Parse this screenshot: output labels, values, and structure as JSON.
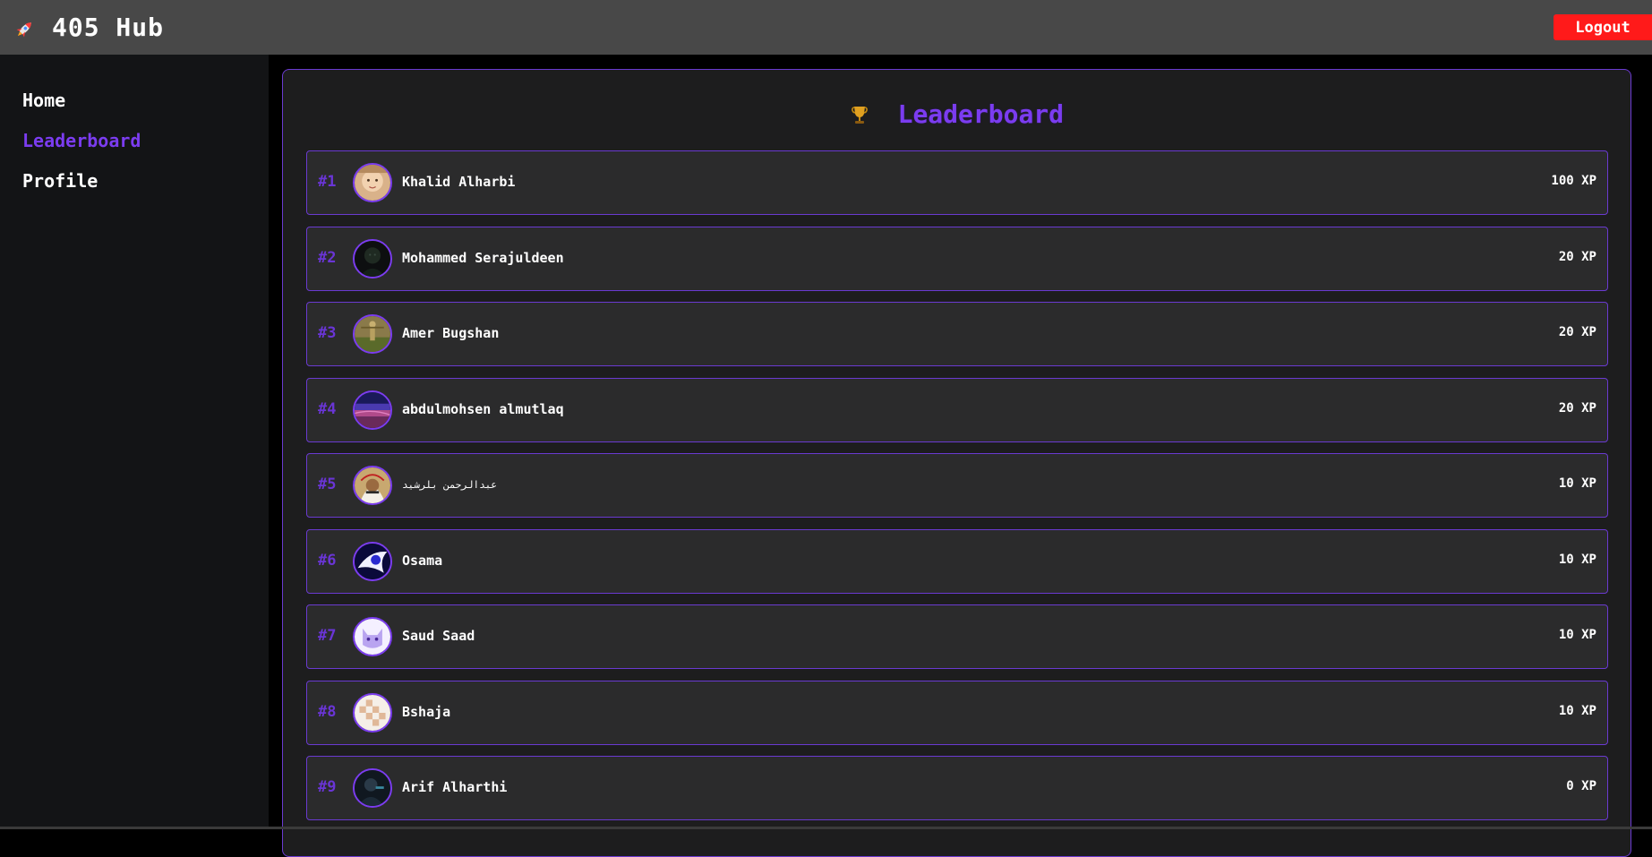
{
  "app": {
    "title": "405 Hub",
    "logout_label": "Logout"
  },
  "sidebar": {
    "items": [
      {
        "label": "Home",
        "active": false
      },
      {
        "label": "Leaderboard",
        "active": true
      },
      {
        "label": "Profile",
        "active": false
      }
    ]
  },
  "leaderboard": {
    "title": "Leaderboard",
    "rows": [
      {
        "rank": "#1",
        "name": "Khalid Alharbi",
        "xp": "100 XP"
      },
      {
        "rank": "#2",
        "name": "Mohammed Serajuldeen",
        "xp": "20 XP"
      },
      {
        "rank": "#3",
        "name": "Amer Bugshan",
        "xp": "20 XP"
      },
      {
        "rank": "#4",
        "name": "abdulmohsen almutlaq",
        "xp": "20 XP"
      },
      {
        "rank": "#5",
        "name": "عبدالرحمن  بلرشيد",
        "xp": "10 XP"
      },
      {
        "rank": "#6",
        "name": "Osama",
        "xp": "10 XP"
      },
      {
        "rank": "#7",
        "name": "Saud Saad",
        "xp": "10 XP"
      },
      {
        "rank": "#8",
        "name": "Bshaja",
        "xp": "10 XP"
      },
      {
        "rank": "#9",
        "name": "Arif Alharthi",
        "xp": "0 XP"
      }
    ]
  },
  "colors": {
    "accent": "#7b3cf0",
    "logout": "#ff1a1a",
    "topbar": "#484848",
    "sidebar": "#131416",
    "panel": "#1d1d1e",
    "row": "#2b2b2c"
  },
  "icons": {
    "brand": "rocket-icon",
    "header": "trophy-icon"
  }
}
